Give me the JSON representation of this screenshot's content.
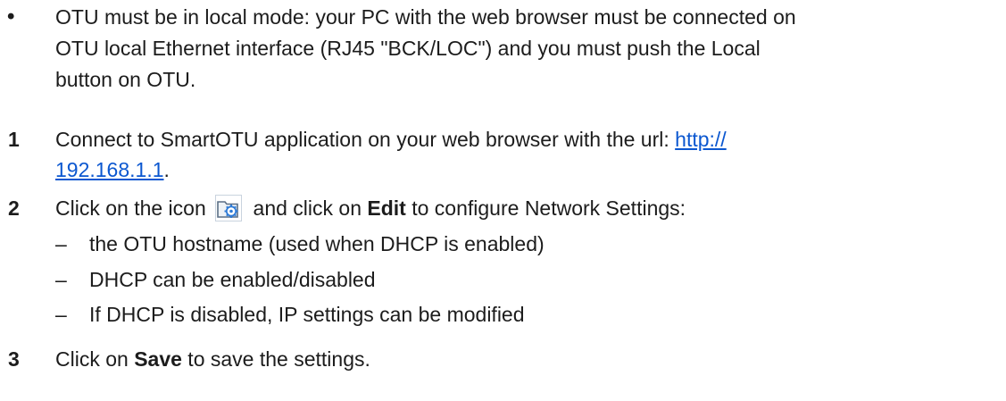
{
  "prereq": {
    "marker": "•",
    "lines": [
      "OTU must be in local mode: your PC with the web browser must be connected on",
      "OTU local Ethernet interface (RJ45 \"BCK/LOC\") and you must push the Local",
      "button on OTU."
    ]
  },
  "steps": [
    {
      "number": "1",
      "text_before_link": "Connect to SmartOTU application on your web browser with the url: ",
      "link_part1": "http://",
      "link_part2": "192.168.1.1",
      "text_after_link": "."
    },
    {
      "number": "2",
      "text_before_icon": "Click on the icon ",
      "icon": "network-settings-folder-gear-icon",
      "text_mid": " and click on ",
      "bold_word": "Edit",
      "text_after": " to configure Network Settings:",
      "subitems": [
        {
          "dash": "–",
          "text": "the OTU hostname (used when DHCP is enabled)"
        },
        {
          "dash": "–",
          "text": "DHCP can be enabled/disabled"
        },
        {
          "dash": "–",
          "text": "If DHCP is disabled, IP settings can be modified"
        }
      ]
    },
    {
      "number": "3",
      "text_before": "Click on ",
      "bold_word": "Save",
      "text_after": " to save the settings."
    }
  ],
  "colors": {
    "link": "#0b57d0",
    "icon_folder": "#5b6f85",
    "icon_gear": "#2f7bd6"
  }
}
